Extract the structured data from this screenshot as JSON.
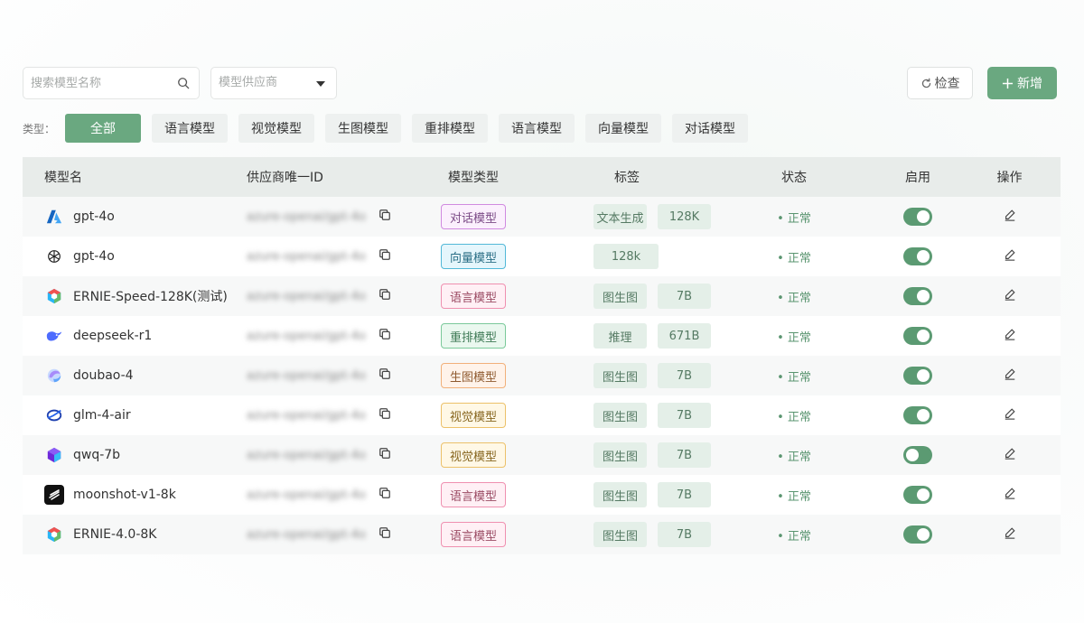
{
  "search": {
    "placeholder": "搜索模型名称"
  },
  "provider_select": {
    "placeholder": "模型供应商"
  },
  "buttons": {
    "check": "检查",
    "add": "新增"
  },
  "filters": {
    "label": "类型：",
    "chips": [
      "全部",
      "语言模型",
      "视觉模型",
      "生图模型",
      "重排模型",
      "语言模型",
      "向量模型",
      "对话模型"
    ],
    "active_index": 0
  },
  "table": {
    "headers": {
      "name": "模型名",
      "id": "供应商唯一ID",
      "type": "模型类型",
      "tags": "标签",
      "status": "状态",
      "enable": "启用",
      "op": "操作"
    },
    "rows": [
      {
        "logo": "azure-icon",
        "name": "gpt-4o",
        "id": "azure-openai/gpt-4o",
        "type": "对话模型",
        "type_class": "b-dialog",
        "tags": [
          "文本生成",
          "128K"
        ],
        "status": "• 正常",
        "enabled": true
      },
      {
        "logo": "openai-icon",
        "name": "gpt-4o",
        "id": "azure-openai/gpt-4o",
        "type": "向量模型",
        "type_class": "b-vector",
        "tags": [
          "128k"
        ],
        "status": "• 正常",
        "enabled": true
      },
      {
        "logo": "ernie-icon",
        "name": "ERNIE-Speed-128K(测试)",
        "id": "azure-openai/gpt-4o",
        "type": "语言模型",
        "type_class": "b-lang",
        "tags": [
          "图生图",
          "7B"
        ],
        "status": "• 正常",
        "enabled": true
      },
      {
        "logo": "deepseek-icon",
        "name": "deepseek-r1",
        "id": "azure-openai/gpt-4o",
        "type": "重排模型",
        "type_class": "b-rerank",
        "tags": [
          "推理",
          "671B"
        ],
        "status": "• 正常",
        "enabled": true
      },
      {
        "logo": "doubao-icon",
        "name": "doubao-4",
        "id": "azure-openai/gpt-4o",
        "type": "生图模型",
        "type_class": "b-img",
        "tags": [
          "图生图",
          "7B"
        ],
        "status": "• 正常",
        "enabled": true
      },
      {
        "logo": "glm-icon",
        "name": "glm-4-air",
        "id": "azure-openai/gpt-4o",
        "type": "视觉模型",
        "type_class": "b-vision",
        "tags": [
          "图生图",
          "7B"
        ],
        "status": "• 正常",
        "enabled": true
      },
      {
        "logo": "qwq-icon",
        "name": "qwq-7b",
        "id": "azure-openai/gpt-4o",
        "type": "视觉模型",
        "type_class": "b-vision",
        "tags": [
          "图生图",
          "7B"
        ],
        "status": "• 正常",
        "enabled": false
      },
      {
        "logo": "moonshot-icon",
        "name": "moonshot-v1-8k",
        "id": "azure-openai/gpt-4o",
        "type": "语言模型",
        "type_class": "b-lang",
        "tags": [
          "图生图",
          "7B"
        ],
        "status": "• 正常",
        "enabled": true
      },
      {
        "logo": "ernie-icon",
        "name": "ERNIE-4.0-8K",
        "id": "azure-openai/gpt-4o",
        "type": "语言模型",
        "type_class": "b-lang",
        "tags": [
          "图生图",
          "7B"
        ],
        "status": "• 正常",
        "enabled": true
      }
    ]
  },
  "colors": {
    "accent": "#6aa880",
    "toggle": "#5b9a72",
    "status": "#5a9570"
  }
}
